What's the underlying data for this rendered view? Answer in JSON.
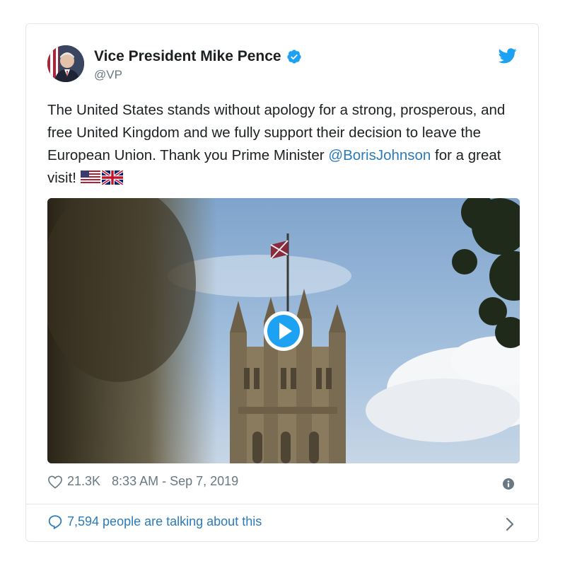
{
  "tweet": {
    "author_name": "Vice President Mike Pence",
    "handle": "@VP",
    "text_part1": "The United States stands without apology for a strong, prosperous, and free United Kingdom and we fully support their decision to leave the European Union. Thank you Prime Minister ",
    "mention": "@BorisJohnson",
    "text_part2": " for a great visit! ",
    "likes": "21.3K",
    "timestamp": "8:33 AM - Sep 7, 2019",
    "talking": "7,594 people are talking about this"
  },
  "icons": {
    "verified": "verified-badge-icon",
    "bird": "twitter-bird-icon",
    "play": "play-icon",
    "heart": "heart-icon",
    "info": "info-icon",
    "bubble": "comment-bubble-icon",
    "chevron": "chevron-right-icon",
    "flags": [
      "us-flag-icon",
      "uk-flag-icon"
    ]
  },
  "colors": {
    "accent": "#1da1f2",
    "link": "#2b7bb9",
    "meta": "#697882",
    "border": "#e1e8ed"
  }
}
